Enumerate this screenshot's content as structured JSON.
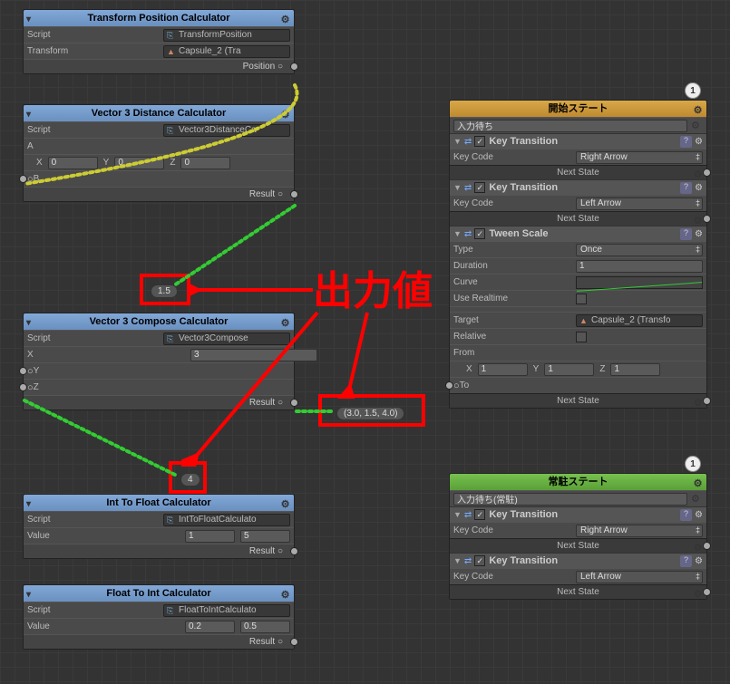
{
  "nodes": {
    "transPos": {
      "title": "Transform Position Calculator",
      "script_label": "Script",
      "script_value": "TransformPosition",
      "transform_label": "Transform",
      "transform_value": "Capsule_2 (Tra",
      "result_label": "Position"
    },
    "vec3dist": {
      "title": "Vector 3 Distance Calculator",
      "script_label": "Script",
      "script_value": "Vector3DistanceCa",
      "a_label": "A",
      "b_label": "B",
      "x_label": "X",
      "y_label": "Y",
      "z_label": "Z",
      "x_val": "0",
      "y_val": "0",
      "z_val": "0",
      "result_label": "Result"
    },
    "vec3comp": {
      "title": "Vector 3 Compose Calculator",
      "script_label": "Script",
      "script_value": "Vector3Compose",
      "x_label": "X",
      "y_label": "Y",
      "z_label": "Z",
      "x_val": "3",
      "result_label": "Result"
    },
    "int2float": {
      "title": "Int To Float Calculator",
      "script_label": "Script",
      "script_value": "IntToFloatCalculato",
      "value_label": "Value",
      "value_a": "1",
      "value_b": "5",
      "result_label": "Result"
    },
    "float2int": {
      "title": "Float To Int Calculator",
      "script_label": "Script",
      "script_value": "FloatToIntCalculato",
      "value_label": "Value",
      "value_a": "0.2",
      "value_b": "0.5",
      "result_label": "Result"
    },
    "startState": {
      "title": "開始ステート",
      "badge": "1",
      "name_field": "入力待ち",
      "key_transition": "Key Transition",
      "key_code": "Key Code",
      "right_arrow": "Right Arrow",
      "left_arrow": "Left Arrow",
      "next_state": "Next State",
      "tween": "Tween Scale",
      "type_label": "Type",
      "type_value": "Once",
      "duration_label": "Duration",
      "duration_value": "1",
      "curve_label": "Curve",
      "use_realtime": "Use Realtime",
      "target_label": "Target",
      "target_value": "Capsule_2 (Transfo",
      "relative_label": "Relative",
      "from_label": "From",
      "to_label": "To",
      "x_label": "X",
      "y_label": "Y",
      "z_label": "Z",
      "from_x": "1",
      "from_y": "1",
      "from_z": "1"
    },
    "residentState": {
      "title": "常駐ステート",
      "badge": "1",
      "name_field": "入力待ち(常駐)",
      "key_transition": "Key Transition",
      "key_code": "Key Code",
      "right_arrow": "Right Arrow",
      "left_arrow": "Left Arrow",
      "next_state": "Next State"
    }
  },
  "pills": {
    "v15": "1.5",
    "v4": "4",
    "vvec": "(3.0, 1.5, 4.0)"
  },
  "annotation": "出力値"
}
